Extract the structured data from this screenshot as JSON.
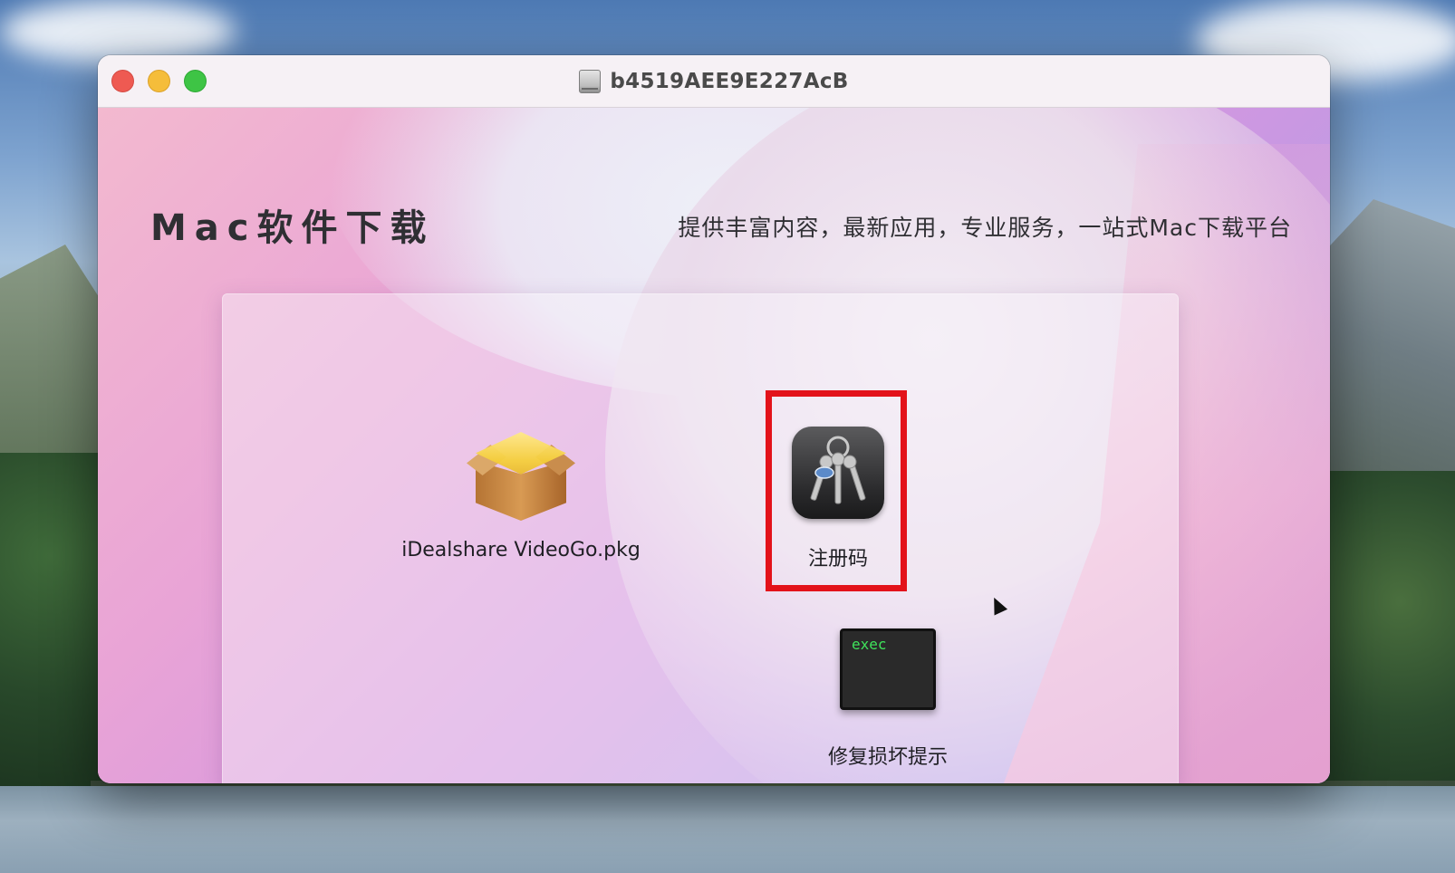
{
  "window": {
    "title": "b4519AEE9E227AcB",
    "title_icon": "disk-image-icon"
  },
  "header": {
    "brand": "Mac软件下载",
    "tagline": "提供丰富内容，最新应用，专业服务，一站式Mac下载平台"
  },
  "items": [
    {
      "label": "iDealshare VideoGo.pkg",
      "icon": "package-icon"
    },
    {
      "label": "注册码",
      "icon": "keychain-icon",
      "highlighted": true,
      "highlight_color": "#e3121a"
    },
    {
      "label": "修复损坏提示",
      "icon": "terminal-exec-icon",
      "icon_text": "exec"
    }
  ],
  "colors": {
    "close": "#ee5a52",
    "minimize": "#f5bd3a",
    "maximize": "#3ec445",
    "exec_text": "#3fe35b"
  }
}
